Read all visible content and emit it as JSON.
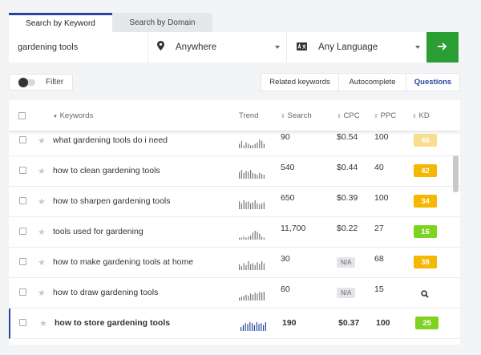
{
  "tabs": {
    "keyword": "Search by Keyword",
    "domain": "Search by Domain"
  },
  "search": {
    "keyword_value": "gardening tools",
    "location": "Anywhere",
    "language": "Any Language",
    "submit_icon": "arrow-right-icon"
  },
  "filter": {
    "label": "Filter"
  },
  "question_types": [
    "Related keywords",
    "Autocomplete",
    "Questions"
  ],
  "table": {
    "headers": {
      "keywords": "Keywords",
      "trend": "Trend",
      "search": "Search",
      "cpc": "CPC",
      "ppc": "PPC",
      "kd": "KD"
    },
    "rows": [
      {
        "keyword": "what gardening tools do i need",
        "search": "90",
        "cpc": "$0.54",
        "cpc_na": false,
        "ppc": "100",
        "kd": "46",
        "kd_color": "#f5c431",
        "kd_faded": true,
        "kd_search": false,
        "trend": [
          3,
          5,
          2,
          4,
          3,
          2,
          2,
          3,
          4,
          6,
          5,
          3
        ],
        "active": false
      },
      {
        "keyword": "how to clean gardening tools",
        "search": "540",
        "cpc": "$0.44",
        "cpc_na": false,
        "ppc": "40",
        "kd": "42",
        "kd_color": "#f5b700",
        "kd_faded": false,
        "kd_search": false,
        "trend": [
          7,
          9,
          6,
          8,
          7,
          9,
          6,
          5,
          4,
          6,
          5,
          4
        ],
        "active": false
      },
      {
        "keyword": "how to sharpen gardening tools",
        "search": "650",
        "cpc": "$0.39",
        "cpc_na": false,
        "ppc": "100",
        "kd": "34",
        "kd_color": "#f5b700",
        "kd_faded": false,
        "kd_search": false,
        "trend": [
          8,
          6,
          9,
          7,
          8,
          6,
          7,
          9,
          6,
          5,
          6,
          7
        ],
        "active": false
      },
      {
        "keyword": "tools used for gardening",
        "search": "11,700",
        "cpc": "$0.22",
        "cpc_na": false,
        "ppc": "27",
        "kd": "16",
        "kd_color": "#7ed321",
        "kd_faded": false,
        "kd_search": false,
        "trend": [
          2,
          2,
          3,
          2,
          3,
          4,
          7,
          9,
          8,
          6,
          3,
          2
        ],
        "active": false
      },
      {
        "keyword": "how to make gardening tools at home",
        "search": "30",
        "cpc": "N/A",
        "cpc_na": true,
        "ppc": "68",
        "kd": "38",
        "kd_color": "#f5b700",
        "kd_faded": false,
        "kd_search": false,
        "trend": [
          6,
          4,
          7,
          5,
          9,
          6,
          7,
          5,
          8,
          6,
          9,
          7
        ],
        "active": false
      },
      {
        "keyword": "how to draw gardening tools",
        "search": "60",
        "cpc": "N/A",
        "cpc_na": true,
        "ppc": "15",
        "kd": "",
        "kd_color": "",
        "kd_faded": false,
        "kd_search": true,
        "trend": [
          3,
          4,
          5,
          6,
          5,
          7,
          6,
          8,
          7,
          9,
          8,
          9
        ],
        "active": false
      },
      {
        "keyword": "how to store gardening tools",
        "search": "190",
        "cpc": "$0.37",
        "cpc_na": false,
        "ppc": "100",
        "kd": "25",
        "kd_color": "#7ed321",
        "kd_faded": false,
        "kd_search": false,
        "trend": [
          4,
          6,
          8,
          7,
          9,
          8,
          6,
          9,
          7,
          8,
          6,
          9
        ],
        "active": true
      }
    ]
  }
}
